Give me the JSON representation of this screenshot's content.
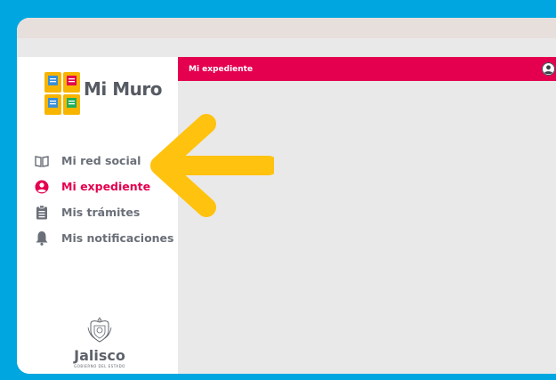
{
  "app": {
    "name": "Mi Muro"
  },
  "sidebar": {
    "items": [
      {
        "label": "Mi red social",
        "icon": "book-open-icon",
        "active": false
      },
      {
        "label": "Mi expediente",
        "icon": "user-circle-icon",
        "active": true
      },
      {
        "label": "Mis trámites",
        "icon": "clipboard-icon",
        "active": false
      },
      {
        "label": "Mis notificaciones",
        "icon": "bell-icon",
        "active": false
      }
    ]
  },
  "footer": {
    "org": "Jalisco",
    "sub": "GOBIERNO DEL ESTADO"
  },
  "header": {
    "title": "Mi expediente"
  },
  "colors": {
    "accent": "#e4004f",
    "background": "#00a6e0",
    "arrow": "#ffc20e"
  }
}
